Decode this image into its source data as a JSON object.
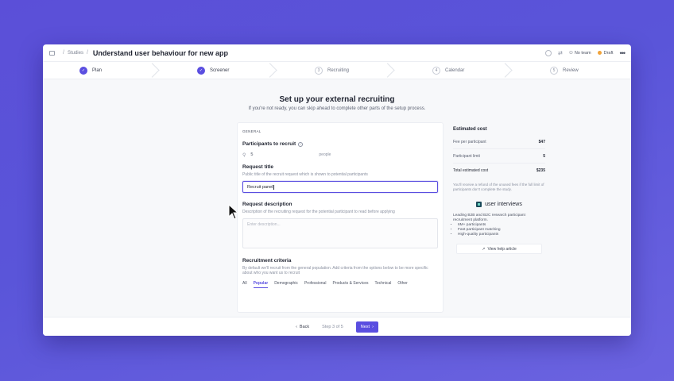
{
  "breadcrumb": {
    "parent": "Studies",
    "title": "Understand user behaviour for new app"
  },
  "topbar": {
    "team_label": "No team",
    "status_label": "Draft"
  },
  "stepper": [
    {
      "number": "✓",
      "label": "Plan",
      "state": "done"
    },
    {
      "number": "✓",
      "label": "Screener",
      "state": "done"
    },
    {
      "number": "3",
      "label": "Recruiting",
      "state": "current"
    },
    {
      "number": "4",
      "label": "Calendar",
      "state": "upcoming"
    },
    {
      "number": "5",
      "label": "Review",
      "state": "upcoming"
    }
  ],
  "page": {
    "heading": "Set up your external recruiting",
    "subheading": "If you're not ready, you can skip ahead to complete other parts of the setup process."
  },
  "form": {
    "section": "GENERAL",
    "participants": {
      "label": "Participants to recruit",
      "value": "5",
      "unit": "people"
    },
    "request_title": {
      "label": "Request title",
      "help": "Public title of the recruit request which is shown to potential participants",
      "value": "Recruit panel"
    },
    "request_description": {
      "label": "Request description",
      "help": "Description of the recruiting request for the potential participant to read before applying",
      "placeholder": "Enter description..."
    },
    "criteria": {
      "label": "Recruitment criteria",
      "help": "By default we'll recruit from the general population. Add criteria from the options below to be more specific about who you want us to recruit",
      "tabs": [
        "All",
        "Popular",
        "Demographic",
        "Professional",
        "Products & Services",
        "Technical",
        "Other"
      ],
      "active_tab": "Popular"
    }
  },
  "cost": {
    "title": "Estimated cost",
    "rows": [
      {
        "label": "Fee per participant",
        "value": "$47"
      },
      {
        "label": "Participant limit",
        "value": "5"
      },
      {
        "label": "Total estimated cost",
        "value": "$235"
      }
    ],
    "refund_note": "You'll receive a refund of the unused fees if the full limit of participants don't complete the study."
  },
  "partner": {
    "name": "user interviews",
    "description": "Leading B2B and B2C research participant recruitment platform.",
    "bullets": [
      "6M+ participants",
      "Fast participant matching",
      "High-quality participants"
    ],
    "help_label": "View help article"
  },
  "footer": {
    "back_label": "Back",
    "step_text": "Step 3 of 5",
    "next_label": "Next"
  },
  "colors": {
    "accent": "#5a4ee0",
    "background": "#5b4fd8"
  }
}
